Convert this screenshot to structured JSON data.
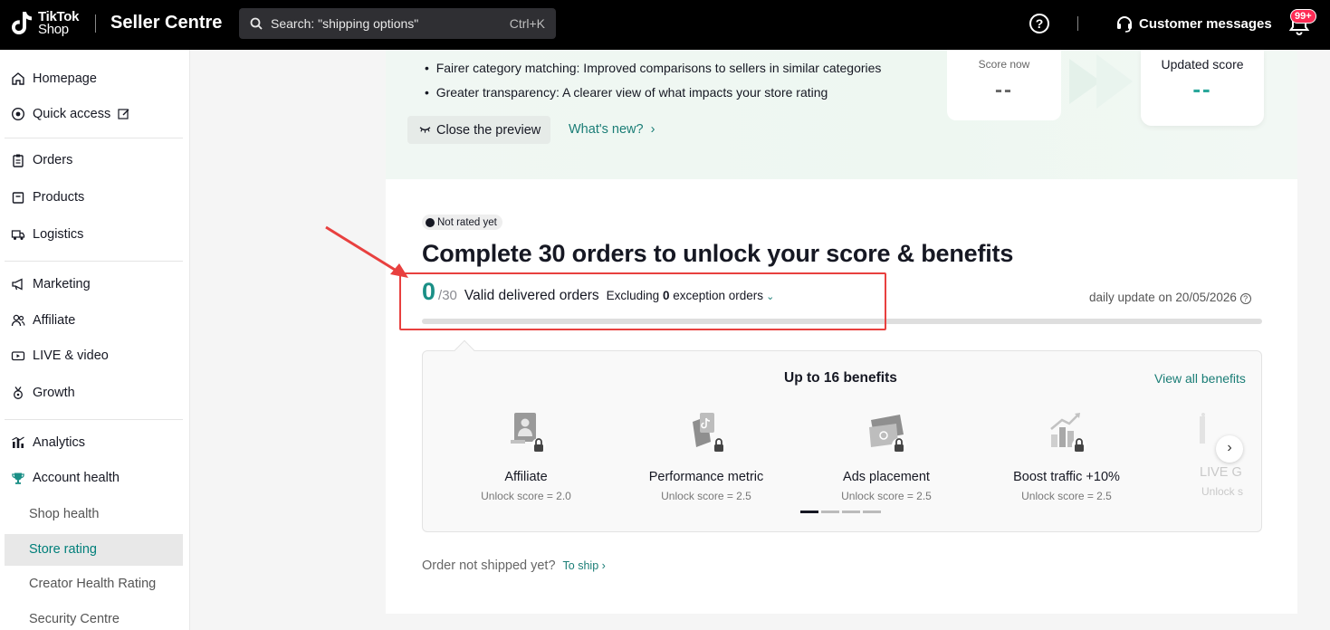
{
  "topbar": {
    "logo_line1": "TikTok",
    "logo_line2": "Shop",
    "brand": "Seller Centre",
    "search_placeholder": "Search: \"shipping options\"",
    "search_shortcut": "Ctrl+K",
    "help_icon": "?",
    "customer_messages": "Customer messages",
    "notification_badge": "99+"
  },
  "sidebar": {
    "items": [
      {
        "label": "Homepage",
        "icon": "home-icon"
      },
      {
        "label": "Quick access",
        "icon": "plus-circle-icon"
      },
      {
        "label": "Orders",
        "icon": "clipboard-icon"
      },
      {
        "label": "Products",
        "icon": "box-icon"
      },
      {
        "label": "Logistics",
        "icon": "truck-icon"
      },
      {
        "label": "Marketing",
        "icon": "megaphone-icon"
      },
      {
        "label": "Affiliate",
        "icon": "people-icon"
      },
      {
        "label": "LIVE & video",
        "icon": "video-icon"
      },
      {
        "label": "Growth",
        "icon": "medal-icon"
      },
      {
        "label": "Analytics",
        "icon": "bar-chart-icon"
      },
      {
        "label": "Account health",
        "icon": "trophy-icon"
      }
    ],
    "sub_items": [
      "Shop health",
      "Store rating",
      "Creator Health Rating",
      "Security Centre"
    ],
    "active_sub": "Store rating"
  },
  "preview": {
    "bullets": [
      "Fairer category matching: Improved comparisons to sellers in similar categories",
      "Greater transparency: A clearer view of what impacts your store rating"
    ],
    "close_label": "Close the preview",
    "whats_new": "What's new?",
    "score_now_label": "Score now",
    "score_now_value": "--",
    "updated_label": "Updated score",
    "updated_value": "--"
  },
  "main": {
    "status": "Not rated yet",
    "headline": "Complete 30 orders to unlock your score & benefits",
    "count": "0",
    "total": "/30",
    "count_label": "Valid delivered orders",
    "excluding_prefix": "Excluding",
    "excluding_count": "0",
    "excluding_suffix": "exception orders",
    "daily_update": "daily update on 20/05/2026",
    "progress": 0
  },
  "benefits": {
    "title": "Up to 16 benefits",
    "view_all": "View all benefits",
    "items": [
      {
        "name": "Affiliate",
        "unlock": "Unlock score = 2.0",
        "icon": "affiliate-lock-icon"
      },
      {
        "name": "Performance metric",
        "unlock": "Unlock score = 2.5",
        "icon": "performance-lock-icon"
      },
      {
        "name": "Ads placement",
        "unlock": "Unlock score = 2.5",
        "icon": "ads-lock-icon"
      },
      {
        "name": "Boost traffic +10%",
        "unlock": "Unlock score = 2.5",
        "icon": "traffic-lock-icon"
      },
      {
        "name": "LIVE G",
        "unlock": "Unlock s",
        "icon": "live-lock-icon"
      }
    ],
    "next_label": "›",
    "page_count": 4,
    "active_page": 1
  },
  "footer": {
    "not_shipped": "Order not shipped yet?",
    "to_ship": "To ship"
  },
  "colors": {
    "accent": "#1a8f86",
    "annotation": "#e8403f",
    "badge": "#fe2c55"
  }
}
